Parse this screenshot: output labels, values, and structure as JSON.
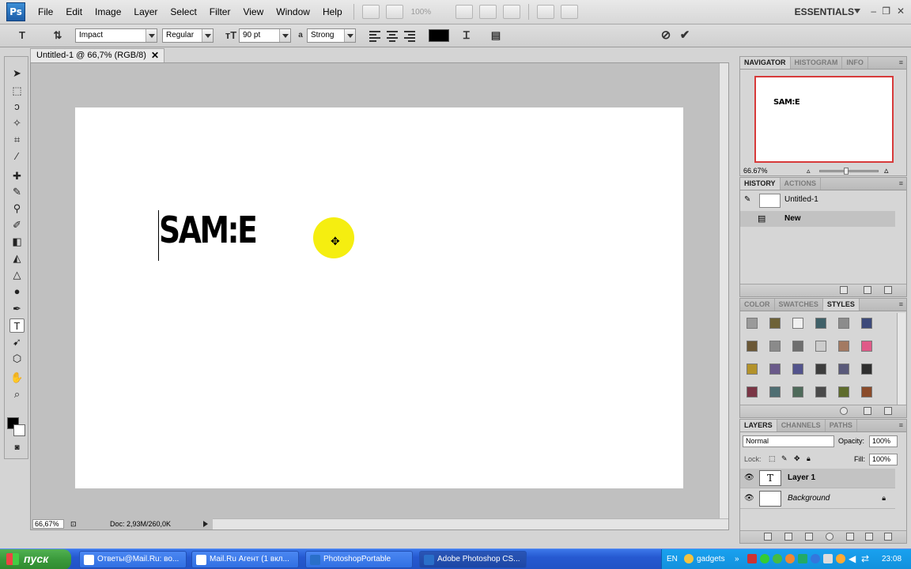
{
  "app": {
    "logo_text": "Ps",
    "workspace": "ESSENTIALS",
    "zoom_level": "100%"
  },
  "menu": {
    "items": [
      "File",
      "Edit",
      "Image",
      "Layer",
      "Select",
      "Filter",
      "View",
      "Window",
      "Help"
    ]
  },
  "options": {
    "font_family": "Impact",
    "font_style": "Regular",
    "font_size": "90 pt",
    "aa_label": "a",
    "antialias": "Strong",
    "text_color": "#000000"
  },
  "document": {
    "tab_title": "Untitled-1 @ 66,7% (RGB/8)",
    "canvas_text": "SAM:E",
    "status_zoom": "66,67%",
    "status_doc": "Doc: 2,93M/260,0K"
  },
  "navigator": {
    "tabs": [
      "NAVIGATOR",
      "HISTOGRAM",
      "INFO"
    ],
    "thumb_text": "SAM:E",
    "zoom": "66.67%"
  },
  "history": {
    "tabs": [
      "HISTORY",
      "ACTIONS"
    ],
    "snapshot": "Untitled-1",
    "state": "New"
  },
  "styles": {
    "tabs": [
      "COLOR",
      "SWATCHES",
      "STYLES"
    ],
    "swatch_colors": [
      "#9a9a9a",
      "#6e6237",
      "#f0f0f0",
      "#3f6068",
      "#8c8c8c",
      "#3d4a7a",
      "#6b5836",
      "#8a8a8a",
      "#6e6e6e",
      "#cccccc",
      "#a37a62",
      "#e05a88",
      "#b3922a",
      "#6a5a8a",
      "#52538c",
      "#3d3d3d",
      "#5a5a7a",
      "#2f2f2f",
      "#7a3545",
      "#4e6e72",
      "#4e6a5a",
      "#4a4a4a",
      "#5e6c2c",
      "#8a4b2a"
    ]
  },
  "layers": {
    "tabs": [
      "LAYERS",
      "CHANNELS",
      "PATHS"
    ],
    "blend_mode": "Normal",
    "opacity_label": "Opacity:",
    "opacity": "100%",
    "lock_label": "Lock:",
    "fill_label": "Fill:",
    "fill": "100%",
    "items": [
      {
        "name": "Layer 1",
        "type": "text",
        "thumb": "T"
      },
      {
        "name": "Background",
        "type": "image",
        "thumb": ""
      }
    ]
  },
  "taskbar": {
    "start_label": "пуск",
    "tasks": [
      "Ответы@Mail.Ru: во...",
      "Mail.Ru Агент (1 вкл...",
      "PhotoshopPortable",
      "Adobe Photoshop CS..."
    ],
    "lang": "EN",
    "gadgets": "gadgets",
    "clock": "23:08"
  }
}
